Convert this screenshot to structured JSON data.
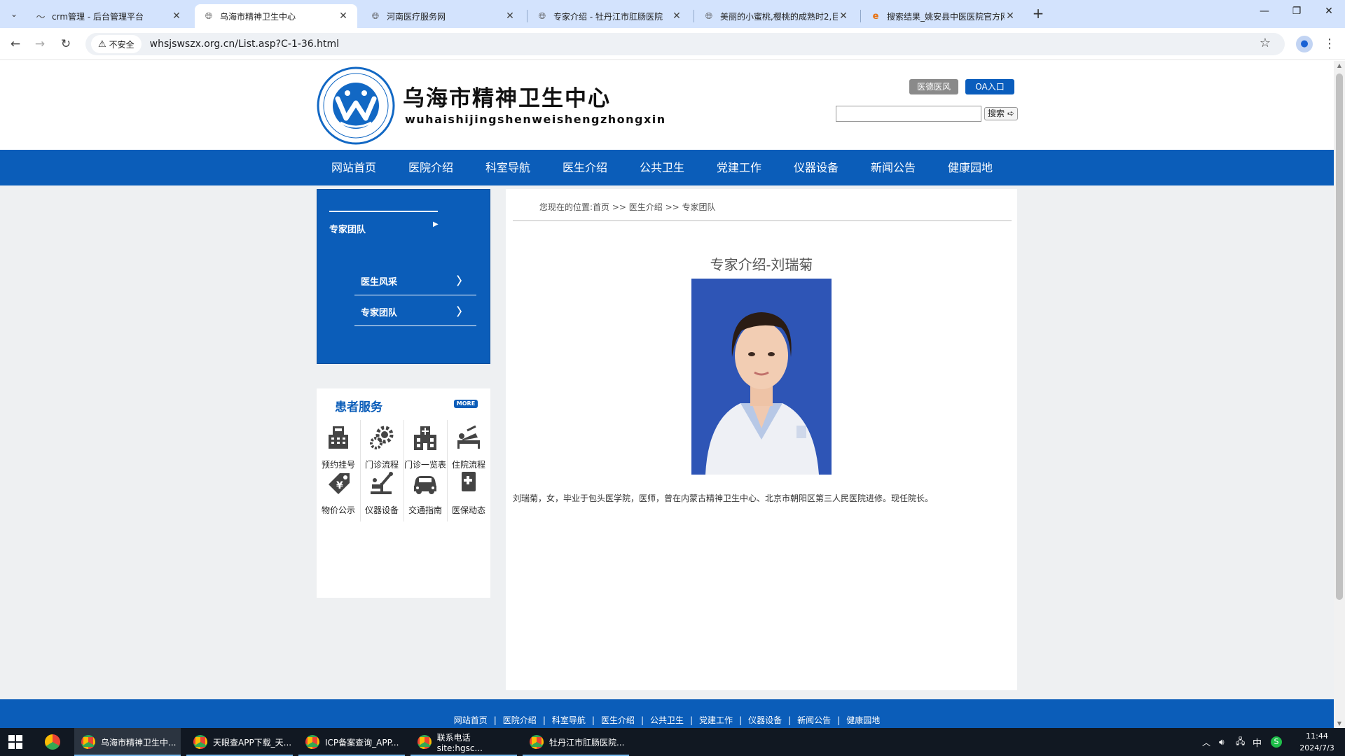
{
  "browser": {
    "tabs": [
      {
        "title": "crm管理 - 后台管理平台",
        "active": false
      },
      {
        "title": "乌海市精神卫生中心",
        "active": true
      },
      {
        "title": "河南医疗服务网",
        "active": false
      },
      {
        "title": "专家介绍 - 牡丹江市肛肠医院",
        "active": false
      },
      {
        "title": "美丽的小蜜桃,樱桃的成熟时2,巨",
        "active": false
      },
      {
        "title": "搜索结果_姚安县中医医院官方网",
        "active": false
      }
    ],
    "security_label": "不安全",
    "url": "whsjswszx.org.cn/List.asp?C-1-36.html"
  },
  "site": {
    "name_cn": "乌海市精神卫生中心",
    "name_pinyin": "wuhaishijingshenweishengzhongxin",
    "header_buttons": {
      "ethics": "医德医风",
      "oa": "OA入口"
    },
    "search": {
      "value": "",
      "button": "搜索"
    },
    "nav": [
      "网站首页",
      "医院介绍",
      "科室导航",
      "医生介绍",
      "公共卫生",
      "党建工作",
      "仪器设备",
      "新闻公告",
      "健康园地"
    ],
    "sidebar": {
      "title": "专家团队",
      "items": [
        "医生风采",
        "专家团队"
      ]
    },
    "patient_services": {
      "title": "患者服务",
      "more": "MORE",
      "items": [
        {
          "label": "预约挂号",
          "icon": "register-machine-icon"
        },
        {
          "label": "门诊流程",
          "icon": "gear-process-icon"
        },
        {
          "label": "门诊一览表",
          "icon": "hospital-building-icon"
        },
        {
          "label": "住院流程",
          "icon": "hospital-bed-icon"
        },
        {
          "label": "物价公示",
          "icon": "price-tag-icon"
        },
        {
          "label": "仪器设备",
          "icon": "microscope-icon"
        },
        {
          "label": "交通指南",
          "icon": "car-icon"
        },
        {
          "label": "医保动态",
          "icon": "insurance-card-icon"
        }
      ]
    },
    "breadcrumb": "您现在的位置:首页 >> 医生介绍 >> 专家团队",
    "article": {
      "title": "专家介绍-刘瑞菊",
      "bio": "刘瑞菊，女，毕业于包头医学院，医师，曾在内蒙古精神卫生中心、北京市朝阳区第三人民医院进修。现任院长。"
    },
    "footer_nav": [
      "网站首页",
      "医院介绍",
      "科室导航",
      "医生介绍",
      "公共卫生",
      "党建工作",
      "仪器设备",
      "新闻公告",
      "健康园地"
    ]
  },
  "taskbar": {
    "apps": [
      {
        "label": "乌海市精神卫生中...",
        "active": true
      },
      {
        "label": "天眼查APP下载_天...",
        "active": false
      },
      {
        "label": "ICP备案查询_APP...",
        "active": false
      },
      {
        "label": "联系电话 site:hgsc...",
        "active": false
      },
      {
        "label": "牡丹江市肛肠医院...",
        "active": false
      }
    ],
    "ime": "中",
    "time": "11:44",
    "date": "2024/7/3"
  },
  "colors": {
    "brand_blue": "#0b5db9",
    "tab_bar": "#d3e3fd",
    "taskbar": "#111822"
  }
}
